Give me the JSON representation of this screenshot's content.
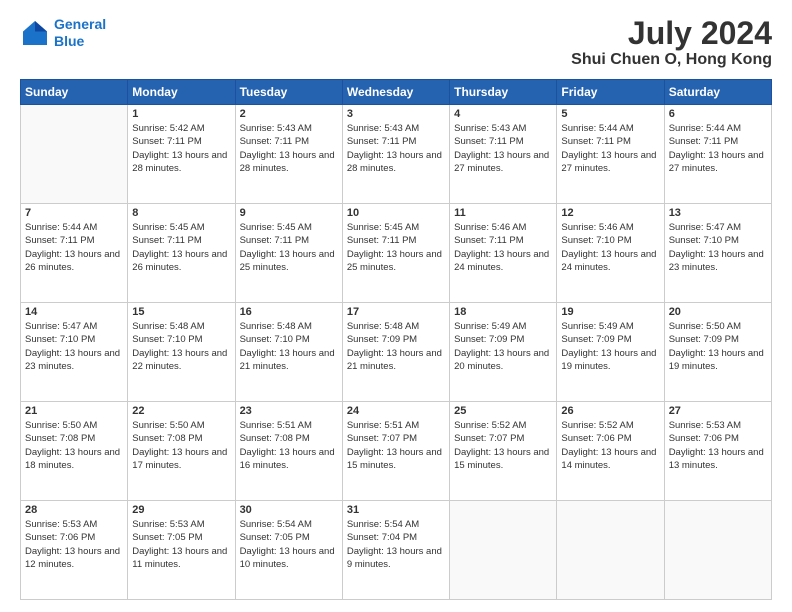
{
  "header": {
    "logo_line1": "General",
    "logo_line2": "Blue",
    "title": "July 2024",
    "subtitle": "Shui Chuen O, Hong Kong"
  },
  "weekdays": [
    "Sunday",
    "Monday",
    "Tuesday",
    "Wednesday",
    "Thursday",
    "Friday",
    "Saturday"
  ],
  "weeks": [
    [
      {
        "day": "",
        "sunrise": "",
        "sunset": "",
        "daylight": ""
      },
      {
        "day": "1",
        "sunrise": "Sunrise: 5:42 AM",
        "sunset": "Sunset: 7:11 PM",
        "daylight": "Daylight: 13 hours and 28 minutes."
      },
      {
        "day": "2",
        "sunrise": "Sunrise: 5:43 AM",
        "sunset": "Sunset: 7:11 PM",
        "daylight": "Daylight: 13 hours and 28 minutes."
      },
      {
        "day": "3",
        "sunrise": "Sunrise: 5:43 AM",
        "sunset": "Sunset: 7:11 PM",
        "daylight": "Daylight: 13 hours and 28 minutes."
      },
      {
        "day": "4",
        "sunrise": "Sunrise: 5:43 AM",
        "sunset": "Sunset: 7:11 PM",
        "daylight": "Daylight: 13 hours and 27 minutes."
      },
      {
        "day": "5",
        "sunrise": "Sunrise: 5:44 AM",
        "sunset": "Sunset: 7:11 PM",
        "daylight": "Daylight: 13 hours and 27 minutes."
      },
      {
        "day": "6",
        "sunrise": "Sunrise: 5:44 AM",
        "sunset": "Sunset: 7:11 PM",
        "daylight": "Daylight: 13 hours and 27 minutes."
      }
    ],
    [
      {
        "day": "7",
        "sunrise": "Sunrise: 5:44 AM",
        "sunset": "Sunset: 7:11 PM",
        "daylight": "Daylight: 13 hours and 26 minutes."
      },
      {
        "day": "8",
        "sunrise": "Sunrise: 5:45 AM",
        "sunset": "Sunset: 7:11 PM",
        "daylight": "Daylight: 13 hours and 26 minutes."
      },
      {
        "day": "9",
        "sunrise": "Sunrise: 5:45 AM",
        "sunset": "Sunset: 7:11 PM",
        "daylight": "Daylight: 13 hours and 25 minutes."
      },
      {
        "day": "10",
        "sunrise": "Sunrise: 5:45 AM",
        "sunset": "Sunset: 7:11 PM",
        "daylight": "Daylight: 13 hours and 25 minutes."
      },
      {
        "day": "11",
        "sunrise": "Sunrise: 5:46 AM",
        "sunset": "Sunset: 7:11 PM",
        "daylight": "Daylight: 13 hours and 24 minutes."
      },
      {
        "day": "12",
        "sunrise": "Sunrise: 5:46 AM",
        "sunset": "Sunset: 7:10 PM",
        "daylight": "Daylight: 13 hours and 24 minutes."
      },
      {
        "day": "13",
        "sunrise": "Sunrise: 5:47 AM",
        "sunset": "Sunset: 7:10 PM",
        "daylight": "Daylight: 13 hours and 23 minutes."
      }
    ],
    [
      {
        "day": "14",
        "sunrise": "Sunrise: 5:47 AM",
        "sunset": "Sunset: 7:10 PM",
        "daylight": "Daylight: 13 hours and 23 minutes."
      },
      {
        "day": "15",
        "sunrise": "Sunrise: 5:48 AM",
        "sunset": "Sunset: 7:10 PM",
        "daylight": "Daylight: 13 hours and 22 minutes."
      },
      {
        "day": "16",
        "sunrise": "Sunrise: 5:48 AM",
        "sunset": "Sunset: 7:10 PM",
        "daylight": "Daylight: 13 hours and 21 minutes."
      },
      {
        "day": "17",
        "sunrise": "Sunrise: 5:48 AM",
        "sunset": "Sunset: 7:09 PM",
        "daylight": "Daylight: 13 hours and 21 minutes."
      },
      {
        "day": "18",
        "sunrise": "Sunrise: 5:49 AM",
        "sunset": "Sunset: 7:09 PM",
        "daylight": "Daylight: 13 hours and 20 minutes."
      },
      {
        "day": "19",
        "sunrise": "Sunrise: 5:49 AM",
        "sunset": "Sunset: 7:09 PM",
        "daylight": "Daylight: 13 hours and 19 minutes."
      },
      {
        "day": "20",
        "sunrise": "Sunrise: 5:50 AM",
        "sunset": "Sunset: 7:09 PM",
        "daylight": "Daylight: 13 hours and 19 minutes."
      }
    ],
    [
      {
        "day": "21",
        "sunrise": "Sunrise: 5:50 AM",
        "sunset": "Sunset: 7:08 PM",
        "daylight": "Daylight: 13 hours and 18 minutes."
      },
      {
        "day": "22",
        "sunrise": "Sunrise: 5:50 AM",
        "sunset": "Sunset: 7:08 PM",
        "daylight": "Daylight: 13 hours and 17 minutes."
      },
      {
        "day": "23",
        "sunrise": "Sunrise: 5:51 AM",
        "sunset": "Sunset: 7:08 PM",
        "daylight": "Daylight: 13 hours and 16 minutes."
      },
      {
        "day": "24",
        "sunrise": "Sunrise: 5:51 AM",
        "sunset": "Sunset: 7:07 PM",
        "daylight": "Daylight: 13 hours and 15 minutes."
      },
      {
        "day": "25",
        "sunrise": "Sunrise: 5:52 AM",
        "sunset": "Sunset: 7:07 PM",
        "daylight": "Daylight: 13 hours and 15 minutes."
      },
      {
        "day": "26",
        "sunrise": "Sunrise: 5:52 AM",
        "sunset": "Sunset: 7:06 PM",
        "daylight": "Daylight: 13 hours and 14 minutes."
      },
      {
        "day": "27",
        "sunrise": "Sunrise: 5:53 AM",
        "sunset": "Sunset: 7:06 PM",
        "daylight": "Daylight: 13 hours and 13 minutes."
      }
    ],
    [
      {
        "day": "28",
        "sunrise": "Sunrise: 5:53 AM",
        "sunset": "Sunset: 7:06 PM",
        "daylight": "Daylight: 13 hours and 12 minutes."
      },
      {
        "day": "29",
        "sunrise": "Sunrise: 5:53 AM",
        "sunset": "Sunset: 7:05 PM",
        "daylight": "Daylight: 13 hours and 11 minutes."
      },
      {
        "day": "30",
        "sunrise": "Sunrise: 5:54 AM",
        "sunset": "Sunset: 7:05 PM",
        "daylight": "Daylight: 13 hours and 10 minutes."
      },
      {
        "day": "31",
        "sunrise": "Sunrise: 5:54 AM",
        "sunset": "Sunset: 7:04 PM",
        "daylight": "Daylight: 13 hours and 9 minutes."
      },
      {
        "day": "",
        "sunrise": "",
        "sunset": "",
        "daylight": ""
      },
      {
        "day": "",
        "sunrise": "",
        "sunset": "",
        "daylight": ""
      },
      {
        "day": "",
        "sunrise": "",
        "sunset": "",
        "daylight": ""
      }
    ]
  ]
}
